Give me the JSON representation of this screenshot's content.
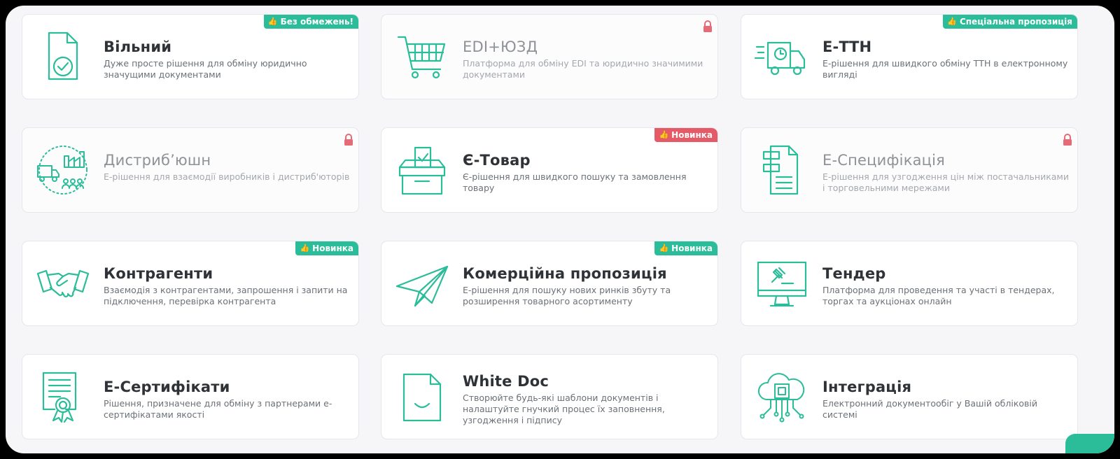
{
  "colors": {
    "accent": "#2bbd9a",
    "new_badge_red": "#e45a66",
    "lock": "#e66b78"
  },
  "cards": [
    {
      "title": "Вільний",
      "desc": "Дуже просте рішення для обміну юридично значущими документами",
      "badge": "Без обмежень!",
      "badge_color": "green",
      "locked": false,
      "icon": "document-check-icon"
    },
    {
      "title": "EDI+ЮЗД",
      "desc": "Платформа для обміну EDI та юридично значимими документами",
      "badge": "",
      "locked": true,
      "icon": "shopping-cart-icon"
    },
    {
      "title": "Е-ТТН",
      "desc": "Е-рішення для швидкого обміну ТТН в електронному вигляді",
      "badge": "Спеціальна пропозиція",
      "badge_color": "green",
      "locked": false,
      "icon": "delivery-truck-icon"
    },
    {
      "title": "Дистриб’юшн",
      "desc": "Е-рішення для взаємодії виробників і дистриб'юторів",
      "badge": "",
      "locked": true,
      "icon": "distribution-icon"
    },
    {
      "title": "Є-Товар",
      "desc": "Є-рішення для швидкого пошуку та замовлення товару",
      "badge": "Новинка",
      "badge_color": "red",
      "locked": false,
      "icon": "product-box-icon"
    },
    {
      "title": "Е-Специфікація",
      "desc": "Е-рішення для узгодження цін між постачальниками і торговельними мережами",
      "badge": "",
      "locked": true,
      "icon": "specification-document-icon"
    },
    {
      "title": "Контрагенти",
      "desc": "Взаємодія з контрагентами, запрошення і запити на підключення, перевірка контрагента",
      "badge": "Новинка",
      "badge_color": "green",
      "locked": false,
      "icon": "handshake-icon"
    },
    {
      "title": "Комерційна пропозиція",
      "desc": "Е-рішення для пошуку нових ринків збуту та розширення товарного асортименту",
      "badge": "Новинка",
      "badge_color": "green",
      "locked": false,
      "icon": "paper-plane-icon"
    },
    {
      "title": "Тендер",
      "desc": "Платформа для проведення та участі в тендерах, торгах та аукціонах онлайн",
      "badge": "",
      "locked": false,
      "icon": "monitor-gavel-icon"
    },
    {
      "title": "Е-Сертифікати",
      "desc": "Рішення, призначене для обміну з партнерами е-сертифікатами якості",
      "badge": "",
      "locked": false,
      "icon": "certificate-icon"
    },
    {
      "title": "White Doc",
      "desc": "Створюйте будь-які шаблони документів і налаштуйте гнучкий процес їх заповнення, узгодження і підпису",
      "badge": "",
      "locked": false,
      "icon": "smile-document-icon"
    },
    {
      "title": "Інтеграція",
      "desc": "Електронний документообіг у Вашій обліковій системі",
      "badge": "",
      "locked": false,
      "icon": "cloud-chip-icon"
    }
  ]
}
